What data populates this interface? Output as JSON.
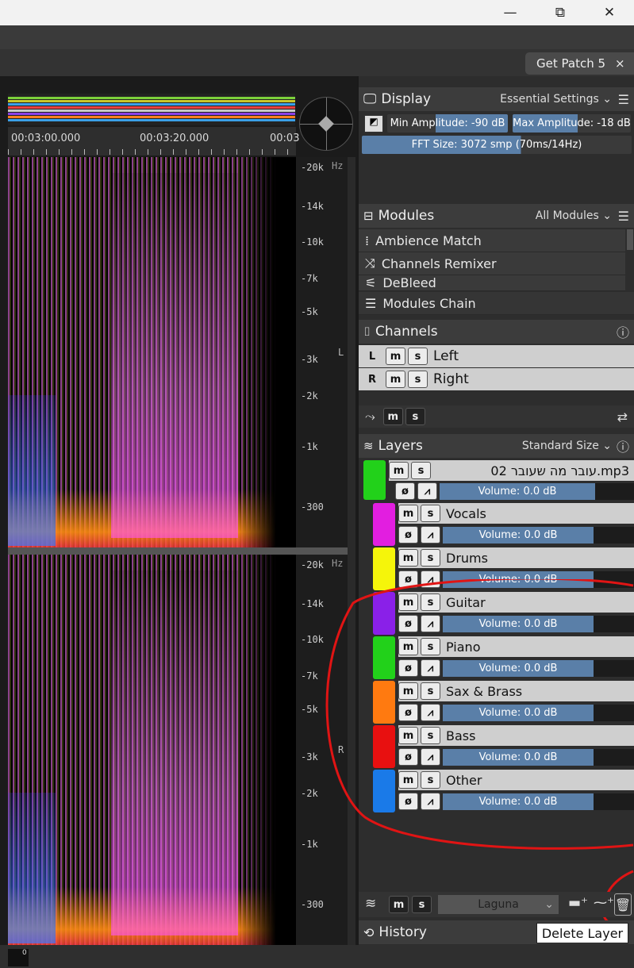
{
  "window": {
    "minimize": "—",
    "maximize": "⧉",
    "close": "✕"
  },
  "tab": {
    "label": "Get Patch 5",
    "close": "×"
  },
  "timeline": {
    "ticks": [
      "00:03:00.000",
      "00:03:20.000",
      "00:03"
    ]
  },
  "freq_scale": {
    "hz": "Hz",
    "labels": [
      "-20k",
      "-14k",
      "-10k",
      "-7k",
      "-5k",
      "-3k",
      "-2k",
      "-1k",
      "-300"
    ]
  },
  "channel_labels": {
    "left": "L",
    "right": "R"
  },
  "display": {
    "title": "Display",
    "preset": "Essential Settings",
    "min_amp": "Min Amplitude: -90 dB",
    "max_amp": "Max Amplitude: -18 dB",
    "fft": "FFT Size: 3072 smp (70ms/14Hz)"
  },
  "modules": {
    "title": "Modules",
    "filter": "All Modules",
    "items": [
      {
        "label": "Ambience Match"
      },
      {
        "label": "Channels Remixer"
      },
      {
        "label": "DeBleed"
      }
    ],
    "chain": "Modules Chain"
  },
  "channels": {
    "title": "Channels",
    "rows": [
      {
        "letter": "L",
        "name": "Left"
      },
      {
        "letter": "R",
        "name": "Right"
      }
    ],
    "m": "m",
    "s": "s"
  },
  "layers": {
    "title": "Layers",
    "size": "Standard Size",
    "file": {
      "name": "02 עובר מה שעובר.mp3",
      "volume": "Volume: 0.0 dB",
      "color": "#22d11a"
    },
    "items": [
      {
        "name": "Vocals",
        "volume": "Volume: 0.0 dB",
        "color": "#e21ee0"
      },
      {
        "name": "Drums",
        "volume": "Volume: 0.0 dB",
        "color": "#f5f50a"
      },
      {
        "name": "Guitar",
        "volume": "Volume: 0.0 dB",
        "color": "#8a20e8"
      },
      {
        "name": "Piano",
        "volume": "Volume: 0.0 dB",
        "color": "#22d11a"
      },
      {
        "name": "Sax & Brass",
        "volume": "Volume: 0.0 dB",
        "color": "#ff7a10"
      },
      {
        "name": "Bass",
        "volume": "Volume: 0.0 dB",
        "color": "#e81010"
      },
      {
        "name": "Other",
        "volume": "Volume: 0.0 dB",
        "color": "#1a7ae8"
      }
    ],
    "preset_box": "Laguna"
  },
  "history": {
    "title": "History"
  },
  "tooltip": {
    "text": "Delete Layer"
  },
  "statusbar": {
    "text": "0"
  }
}
